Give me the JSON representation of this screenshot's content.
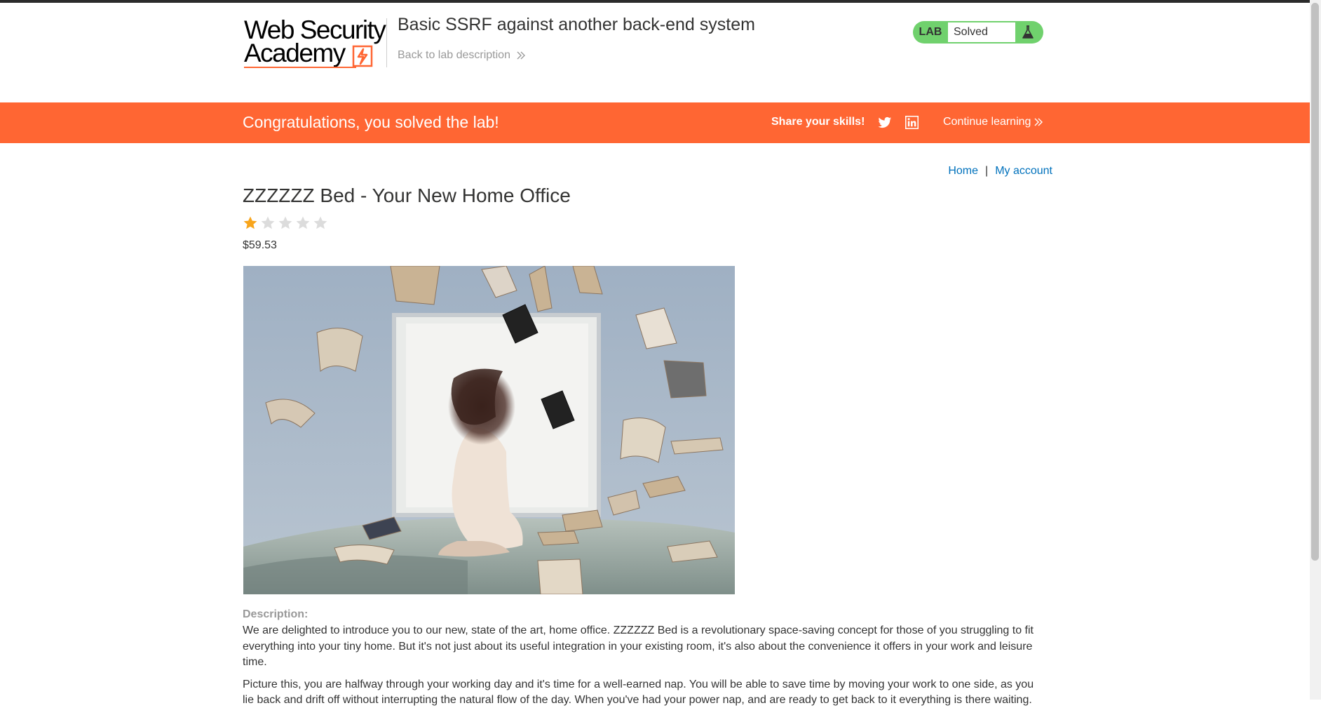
{
  "header": {
    "logo_line1": "Web Security",
    "logo_line2": "Academy",
    "lab_title": "Basic SSRF against another back-end system",
    "back_link": "Back to lab description",
    "lab_badge_label": "LAB",
    "lab_status": "Solved"
  },
  "banner": {
    "message": "Congratulations, you solved the lab!",
    "share_label": "Share your skills!",
    "continue_label": "Continue learning"
  },
  "nav": {
    "home": "Home",
    "separator": "|",
    "my_account": "My account"
  },
  "product": {
    "title": "ZZZZZZ Bed - Your New Home Office",
    "rating": 1,
    "rating_max": 5,
    "price": "$59.53",
    "description_label": "Description:",
    "description_p1": "We are delighted to introduce you to our new, state of the art, home office. ZZZZZZ Bed is a revolutionary space-saving concept for those of you struggling to fit everything into your tiny home. But it's not just about its useful integration in your existing room, it's also about the convenience it offers in your work and leisure time.",
    "description_p2": "Picture this, you are halfway through your working day and it's time for a well-earned nap. You will be able to save time by moving your work to one side, as you lie back and drift off without interrupting the natural flow of the day. When you've had your power nap, and are ready to get back to it everything is there waiting."
  },
  "colors": {
    "accent": "#ff6633",
    "lab_green": "#70d16d",
    "link": "#0071bc",
    "star_filled": "#f8a51c",
    "star_empty": "#dcdcdc"
  },
  "icons": {
    "back": "double-chevron-right-icon",
    "lab": "flask-icon",
    "twitter": "twitter-icon",
    "linkedin": "linkedin-icon",
    "continue": "double-chevron-right-icon"
  }
}
